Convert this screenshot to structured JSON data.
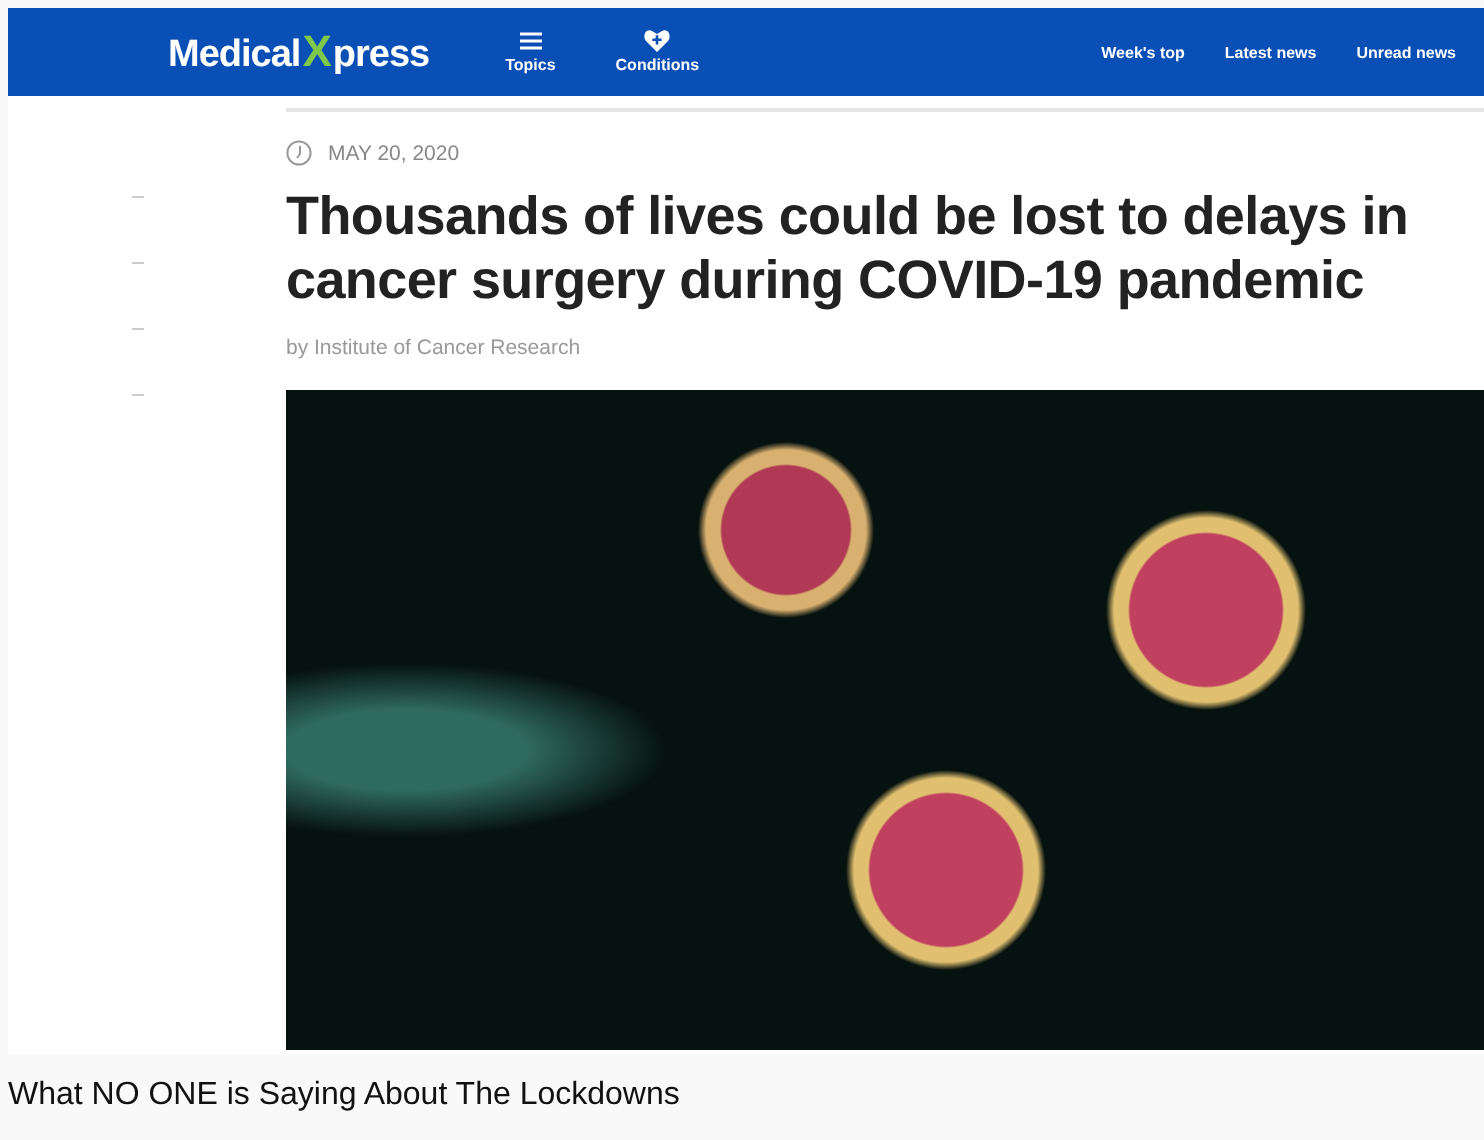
{
  "header": {
    "logo": {
      "left": "Medical",
      "middle": "X",
      "right": "press"
    },
    "nav": [
      "Topics",
      "Conditions"
    ],
    "links": [
      "Week's top",
      "Latest news",
      "Unread news"
    ]
  },
  "article": {
    "date": "MAY 20, 2020",
    "title": "Thousands of lives could be lost to delays in cancer surgery during COVID-19 pandemic",
    "byline": "by Institute of Cancer Research"
  },
  "caption": "What NO ONE is Saying About The Lockdowns"
}
